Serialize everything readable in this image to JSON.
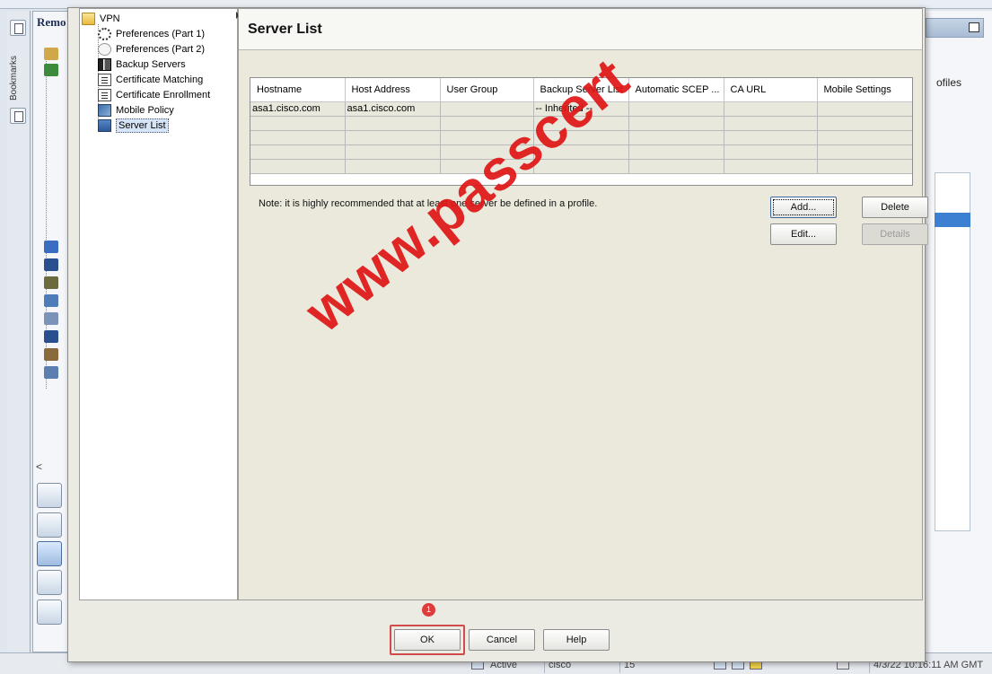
{
  "background": {
    "nav_title": "Remo",
    "bookmarks_label": "Bookmarks",
    "profiles_text": "ofiles",
    "scroll_left": "<",
    "status": {
      "active": "Active",
      "user": "cisco",
      "count": "15",
      "timestamp": "4/3/22 10:16:11 AM GMT"
    }
  },
  "tree": {
    "items": [
      {
        "label": "VPN",
        "icon": "folder-icon"
      },
      {
        "label": "Preferences (Part 1)",
        "icon": "gear-icon"
      },
      {
        "label": "Preferences (Part 2)",
        "icon": "gear-icon"
      },
      {
        "label": "Backup Servers",
        "icon": "server-icon"
      },
      {
        "label": "Certificate Matching",
        "icon": "certificate-icon"
      },
      {
        "label": "Certificate Enrollment",
        "icon": "certificate-icon"
      },
      {
        "label": "Mobile Policy",
        "icon": "mobile-icon"
      },
      {
        "label": "Server List",
        "icon": "server-list-icon"
      }
    ]
  },
  "content": {
    "title": "Server List",
    "table": {
      "columns": [
        "Hostname",
        "Host Address",
        "User Group",
        "Backup Server List",
        "Automatic SCEP ...",
        "CA URL",
        "Mobile Settings"
      ],
      "rows": [
        [
          "asa1.cisco.com",
          "asa1.cisco.com",
          "",
          "-- Inherited --",
          "",
          "",
          ""
        ]
      ],
      "empty_rows": 4
    },
    "note": "Note: it is highly recommended that at least one server be defined in a profile.",
    "buttons": {
      "add": "Add...",
      "delete": "Delete",
      "edit": "Edit...",
      "details": "Details"
    }
  },
  "footer": {
    "ok": "OK",
    "cancel": "Cancel",
    "help": "Help",
    "step_badge": "1"
  },
  "watermark": "www.passcert",
  "colors": {
    "highlight": "#d34a4a",
    "watermark": "#e01616",
    "selection": "#3d7fd1"
  }
}
